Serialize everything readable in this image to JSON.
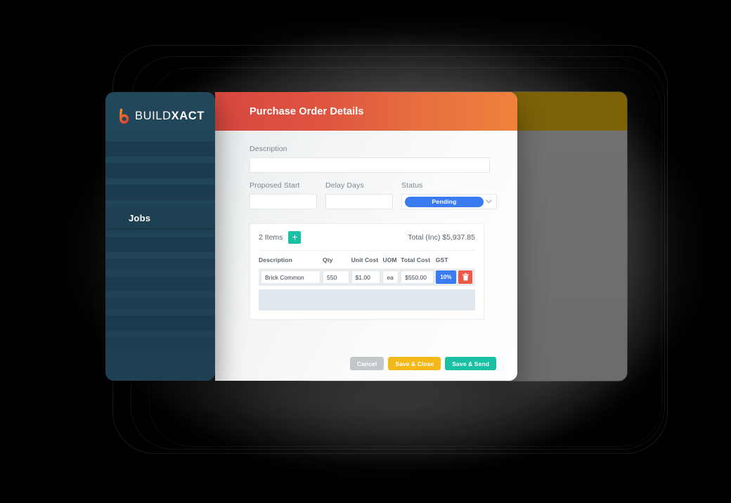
{
  "brand": {
    "logo_text_light": "BUILD",
    "logo_text_bold": "XACT",
    "logo_icon": "buildxact-b-icon",
    "accent_red": "#d9483f",
    "accent_orange": "#ef823c",
    "sidebar_navy": "#22475a",
    "teal": "#19c0a4",
    "amber": "#f5b819",
    "blue": "#3a7bf2",
    "danger_red": "#ee5a4a"
  },
  "sidebar": {
    "active_item": "Jobs"
  },
  "header": {
    "title": "Purchase Order Details"
  },
  "form": {
    "description": {
      "label": "Description",
      "value": "",
      "placeholder": ""
    },
    "proposed_start": {
      "label": "Proposed Start",
      "value": "",
      "placeholder": ""
    },
    "delay_days": {
      "label": "Delay Days",
      "value": "",
      "placeholder": ""
    },
    "status": {
      "label": "Status",
      "value": "Pending",
      "chevron": "chevron-down-icon"
    }
  },
  "items": {
    "count_label": "2 Items",
    "add_label": "+",
    "total_label": "Total (Inc) $5,937.85",
    "columns": [
      "Description",
      "Qty",
      "Unit Cost",
      "UOM",
      "Total Cost",
      "GST"
    ],
    "rows": [
      {
        "description": "Brick Common",
        "qty": "550",
        "unit_cost": "$1.00",
        "uom": "ea",
        "total_cost": "$550.00",
        "gst": "10%",
        "delete_icon": "trash-icon"
      }
    ],
    "empty_row": ""
  },
  "footer": {
    "cancel_label": "Cancel",
    "save_close_label": "Save & Close",
    "save_send_label": "Save & Send"
  }
}
